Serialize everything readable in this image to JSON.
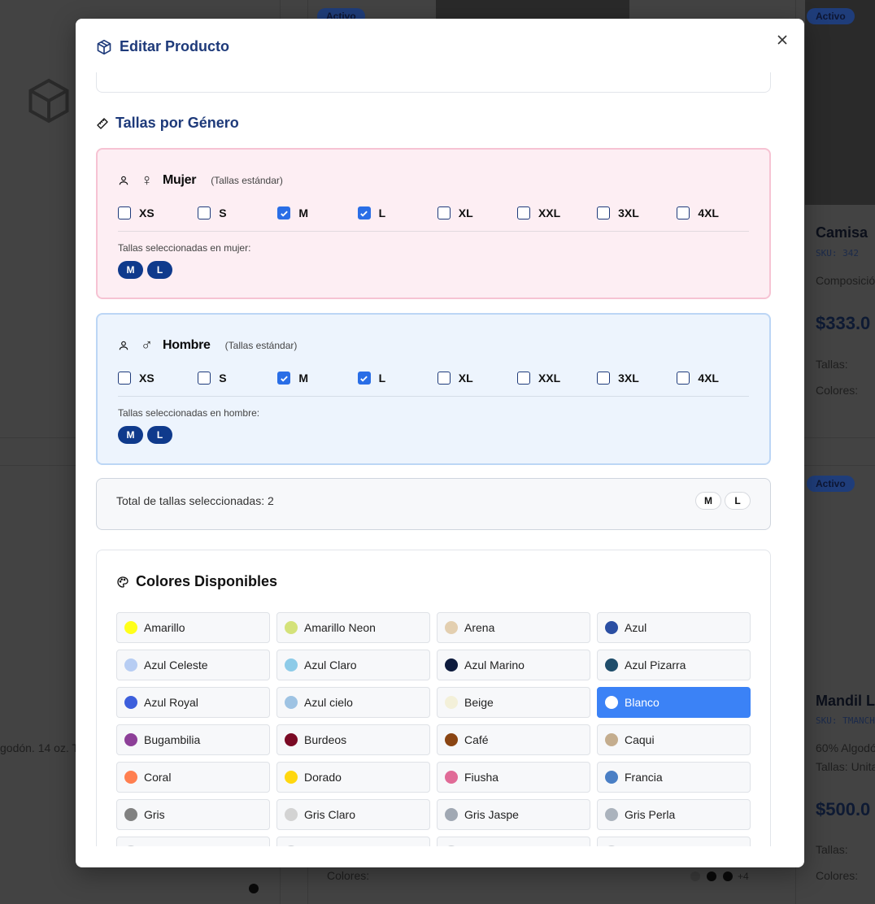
{
  "background": {
    "badge_active": "Activo",
    "product_top_right": {
      "title": "Camisa",
      "sku": "SKU: 342",
      "desc": "Composició",
      "price": "$333.0",
      "sizes_label": "Tallas:",
      "colors_label": "Colores:"
    },
    "product_bottom_right": {
      "title": "Mandil L",
      "sku": "SKU: TMANCH",
      "desc": "60% Algodó",
      "desc2": "Tallas: Unita",
      "price": "$500.0",
      "sizes_label": "Tallas:",
      "colors_label": "Colores:"
    },
    "product_bottom_left_desc": "godón. 14 oz. T",
    "middle_colors_label": "Colores:",
    "middle_more_colors": "+4"
  },
  "modal": {
    "title": "Editar Producto",
    "icon": "package-icon",
    "sizes_section": {
      "title": "Tallas por Género",
      "icon": "ruler-icon",
      "genders": [
        {
          "name": "Mujer",
          "symbol": "♀",
          "note": "(Tallas estándar)",
          "selected_label": "Tallas seleccionadas en mujer:",
          "sizes": [
            {
              "label": "XS",
              "checked": false
            },
            {
              "label": "S",
              "checked": false
            },
            {
              "label": "M",
              "checked": true
            },
            {
              "label": "L",
              "checked": true
            },
            {
              "label": "XL",
              "checked": false
            },
            {
              "label": "XXL",
              "checked": false
            },
            {
              "label": "3XL",
              "checked": false
            },
            {
              "label": "4XL",
              "checked": false
            }
          ],
          "selected": [
            "M",
            "L"
          ]
        },
        {
          "name": "Hombre",
          "symbol": "♂",
          "note": "(Tallas estándar)",
          "selected_label": "Tallas seleccionadas en hombre:",
          "sizes": [
            {
              "label": "XS",
              "checked": false
            },
            {
              "label": "S",
              "checked": false
            },
            {
              "label": "M",
              "checked": true
            },
            {
              "label": "L",
              "checked": true
            },
            {
              "label": "XL",
              "checked": false
            },
            {
              "label": "XXL",
              "checked": false
            },
            {
              "label": "3XL",
              "checked": false
            },
            {
              "label": "4XL",
              "checked": false
            }
          ],
          "selected": [
            "M",
            "L"
          ]
        }
      ],
      "total_label": "Total de tallas seleccionadas: 2",
      "total_pills": [
        "M",
        "L"
      ]
    },
    "colors_section": {
      "title": "Colores Disponibles",
      "icon": "palette-icon",
      "colors": [
        {
          "name": "Amarillo",
          "hex": "#ffff1a",
          "selected": false
        },
        {
          "name": "Amarillo Neon",
          "hex": "#d4e27a",
          "selected": false
        },
        {
          "name": "Arena",
          "hex": "#e3cfb0",
          "selected": false
        },
        {
          "name": "Azul",
          "hex": "#2b4fa3",
          "selected": false
        },
        {
          "name": "Azul Celeste",
          "hex": "#b7cdf3",
          "selected": false
        },
        {
          "name": "Azul Claro",
          "hex": "#8dcbe8",
          "selected": false
        },
        {
          "name": "Azul Marino",
          "hex": "#0d1b3d",
          "selected": false
        },
        {
          "name": "Azul Pizarra",
          "hex": "#1f4d6b",
          "selected": false
        },
        {
          "name": "Azul Royal",
          "hex": "#3d5fdc",
          "selected": false
        },
        {
          "name": "Azul cielo",
          "hex": "#9ec3e3",
          "selected": false
        },
        {
          "name": "Beige",
          "hex": "#f3f0d9",
          "selected": false
        },
        {
          "name": "Blanco",
          "hex": "#ffffff",
          "selected": true
        },
        {
          "name": "Bugambilia",
          "hex": "#8d3f98",
          "selected": false
        },
        {
          "name": "Burdeos",
          "hex": "#7a0a24",
          "selected": false
        },
        {
          "name": "Café",
          "hex": "#8a4513",
          "selected": false
        },
        {
          "name": "Caqui",
          "hex": "#c4ad8e",
          "selected": false
        },
        {
          "name": "Coral",
          "hex": "#ff7f50",
          "selected": false
        },
        {
          "name": "Dorado",
          "hex": "#ffd70f",
          "selected": false
        },
        {
          "name": "Fiusha",
          "hex": "#e06b97",
          "selected": false
        },
        {
          "name": "Francia",
          "hex": "#4a7fc5",
          "selected": false
        },
        {
          "name": "Gris",
          "hex": "#818181",
          "selected": false
        },
        {
          "name": "Gris Claro",
          "hex": "#d3d3d3",
          "selected": false
        },
        {
          "name": "Gris Jaspe",
          "hex": "#a0a8b3",
          "selected": false
        },
        {
          "name": "Gris Perla",
          "hex": "#abb3bd",
          "selected": false
        }
      ]
    }
  }
}
